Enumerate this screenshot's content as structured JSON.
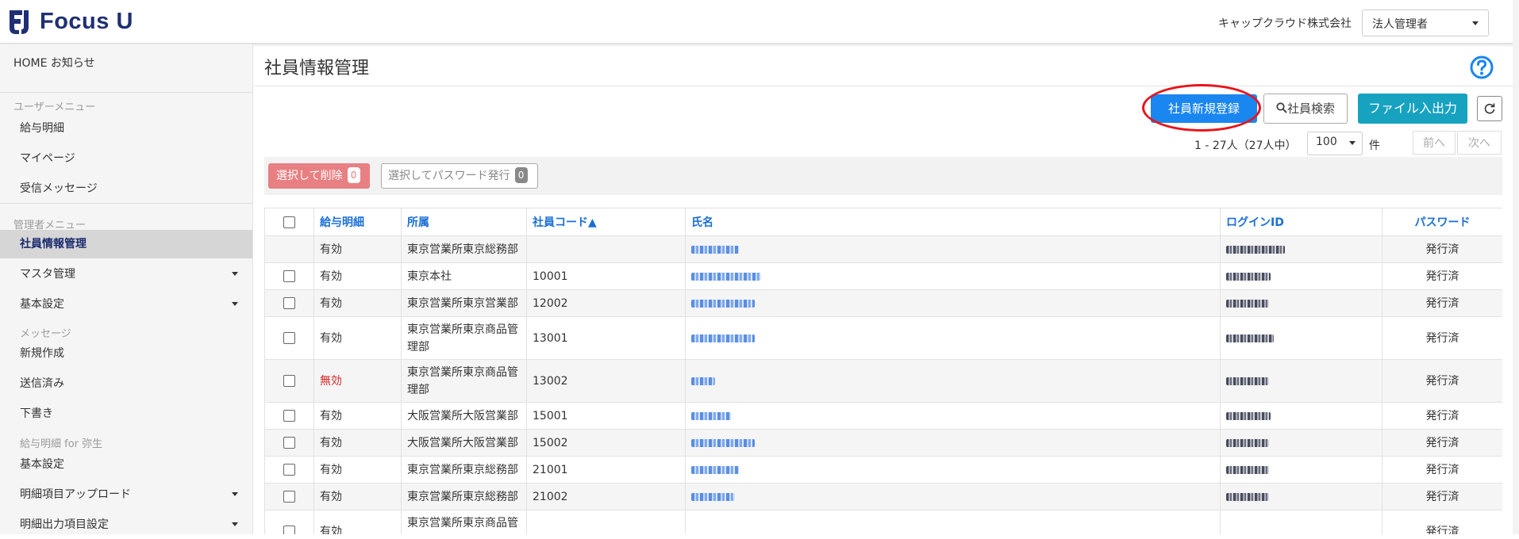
{
  "header": {
    "brand": "Focus U",
    "company": "キャップクラウド株式会社",
    "role": "法人管理者"
  },
  "sidebar": {
    "home": "HOME お知らせ",
    "user_menu_header": "ユーザーメニュー",
    "user_items": [
      "給与明細",
      "マイページ",
      "受信メッセージ"
    ],
    "admin_menu_header": "管理者メニュー",
    "admin_items": [
      "社員情報管理",
      "マスタ管理",
      "基本設定"
    ],
    "message_header": "メッセージ",
    "message_items": [
      "新規作成",
      "送信済み",
      "下書き"
    ],
    "yayoi_header": "給与明細 for 弥生",
    "yayoi_items": [
      "基本設定",
      "明細項目アップロード",
      "明細出力項目設定"
    ]
  },
  "page": {
    "title": "社員情報管理",
    "buttons": {
      "new_employee": "社員新規登録",
      "search": "社員検索",
      "file_io": "ファイル入出力"
    },
    "count_text": "1 - 27人（27人中）",
    "per_page": "100",
    "unit": "件",
    "prev": "前へ",
    "next": "次へ",
    "bulk_delete": "選択して削除",
    "bulk_delete_count": "0",
    "bulk_password": "選択してパスワード発行",
    "bulk_password_count": "0"
  },
  "table": {
    "headers": {
      "payslip": "給与明細",
      "dept": "所属",
      "code": "社員コード▲",
      "name": "氏名",
      "login": "ログインID",
      "password": "パスワード"
    },
    "rows": [
      {
        "payslip": "有効",
        "dept": "東京営業所東京総務部",
        "code": "",
        "password": "発行済",
        "checkbox": false
      },
      {
        "payslip": "有効",
        "dept": "東京本社",
        "code": "10001",
        "password": "発行済",
        "checkbox": true
      },
      {
        "payslip": "有効",
        "dept": "東京営業所東京営業部",
        "code": "12002",
        "password": "発行済",
        "checkbox": true
      },
      {
        "payslip": "有効",
        "dept": "東京営業所東京商品管理部",
        "code": "13001",
        "password": "発行済",
        "checkbox": true
      },
      {
        "payslip": "無効",
        "dept": "東京営業所東京商品管理部",
        "code": "13002",
        "password": "発行済",
        "checkbox": true
      },
      {
        "payslip": "有効",
        "dept": "大阪営業所大阪営業部",
        "code": "15001",
        "password": "発行済",
        "checkbox": true
      },
      {
        "payslip": "有効",
        "dept": "大阪営業所大阪営業部",
        "code": "15002",
        "password": "発行済",
        "checkbox": true
      },
      {
        "payslip": "有効",
        "dept": "東京営業所東京総務部",
        "code": "21001",
        "password": "発行済",
        "checkbox": true
      },
      {
        "payslip": "有効",
        "dept": "東京営業所東京総務部",
        "code": "21002",
        "password": "発行済",
        "checkbox": true
      },
      {
        "payslip": "有効",
        "dept": "東京営業所東京商品管理部",
        "code": "",
        "password": "発行済",
        "checkbox": true
      }
    ]
  },
  "colors": {
    "primary": "#1a86f0",
    "teal": "#17a2c0",
    "link": "#1a6fd6",
    "danger": "#e87f82",
    "highlight_circle": "#e8141b",
    "brand": "#1f2f74"
  }
}
